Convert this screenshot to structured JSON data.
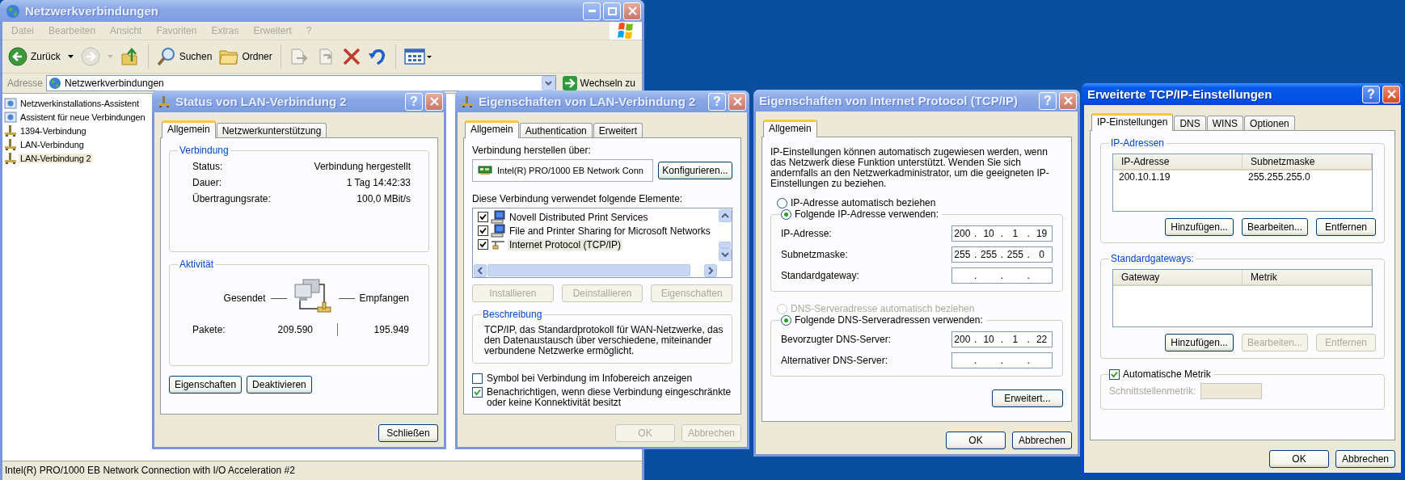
{
  "explorer": {
    "title": "Netzwerkverbindungen",
    "active": false,
    "menu": [
      "Datei",
      "Bearbeiten",
      "Ansicht",
      "Favoriten",
      "Extras",
      "Erweitert",
      "?"
    ],
    "toolbar": {
      "back": "Zurück",
      "search": "Suchen",
      "folders": "Ordner"
    },
    "address": {
      "label": "Adresse",
      "value": "Netzwerkverbindungen",
      "go": "Wechseln zu"
    },
    "items": [
      {
        "label": "Netzwerkinstallations-Assistent",
        "kind": "wizard",
        "selected": false
      },
      {
        "label": "Assistent für neue Verbindungen",
        "kind": "wizard",
        "selected": false
      },
      {
        "label": "1394-Verbindung",
        "kind": "connection",
        "selected": false
      },
      {
        "label": "LAN-Verbindung",
        "kind": "connection",
        "selected": false
      },
      {
        "label": "LAN-Verbindung 2",
        "kind": "connection",
        "selected": true
      }
    ],
    "status_bar": "Intel(R) PRO/1000 EB Network Connection with I/O Acceleration #2"
  },
  "status_dialog": {
    "title": "Status von LAN-Verbindung 2",
    "active": false,
    "help": "?",
    "tabs": [
      {
        "label": "Allgemein",
        "selected": true
      },
      {
        "label": "Netzwerkunterstützung",
        "selected": false
      }
    ],
    "connection": {
      "title": "Verbindung",
      "rows": [
        {
          "label": "Status:",
          "value": "Verbindung hergestellt"
        },
        {
          "label": "Dauer:",
          "value": "1 Tag 14:42:33"
        },
        {
          "label": "Übertragungsrate:",
          "value": "100,0 MBit/s"
        }
      ]
    },
    "activity": {
      "title": "Aktivität",
      "sent_label": "Gesendet",
      "received_label": "Empfangen",
      "packets_label": "Pakete:",
      "packets_sent": "209.590",
      "packets_received": "195.949"
    },
    "buttons": [
      "Eigenschaften",
      "Deaktivieren"
    ],
    "close": "Schließen"
  },
  "properties_dialog": {
    "title": "Eigenschaften von LAN-Verbindung 2",
    "active": false,
    "help": "?",
    "tabs": [
      {
        "label": "Allgemein",
        "selected": true
      },
      {
        "label": "Authentication",
        "selected": false
      },
      {
        "label": "Erweitert",
        "selected": false
      }
    ],
    "connect_label": "Verbindung herstellen über:",
    "adapter": "Intel(R) PRO/1000 EB Network Conn",
    "configure": "Konfigurieren...",
    "components_label": "Diese Verbindung verwendet folgende Elemente:",
    "components": [
      {
        "label": "Novell Distributed Print Services",
        "kind": "service",
        "checked": true,
        "selected": false
      },
      {
        "label": "File and Printer Sharing for Microsoft Networks",
        "kind": "service",
        "checked": true,
        "selected": false
      },
      {
        "label": "Internet Protocol (TCP/IP)",
        "kind": "protocol",
        "checked": true,
        "selected": true
      }
    ],
    "component_buttons": [
      {
        "label": "Installieren",
        "disabled": true
      },
      {
        "label": "Deinstallieren",
        "disabled": true
      },
      {
        "label": "Eigenschaften",
        "disabled": true
      }
    ],
    "description": {
      "title": "Beschreibung",
      "text": "TCP/IP, das Standardprotokoll für WAN-Netzwerke, das den Datenaustausch über verschiedene, miteinander verbundene Netzwerke ermöglicht."
    },
    "options": [
      {
        "label": "Symbol bei Verbindung im Infobereich anzeigen",
        "checked": false
      },
      {
        "label": "Benachrichtigen, wenn diese Verbindung eingeschränkte oder keine Konnektivität besitzt",
        "checked": true
      }
    ],
    "buttons": [
      {
        "label": "OK",
        "disabled": true
      },
      {
        "label": "Abbrechen",
        "disabled": true
      }
    ]
  },
  "tcpip_dialog": {
    "title": "Eigenschaften von Internet Protocol (TCP/IP)",
    "active": false,
    "help": "?",
    "tabs": [
      {
        "label": "Allgemein",
        "selected": true
      }
    ],
    "intro": "IP-Einstellungen können automatisch zugewiesen werden, wenn das Netzwerk diese Funktion unterstützt. Wenden Sie sich andernfalls an den Netzwerkadministrator, um die geeigneten IP-Einstellungen zu beziehen.",
    "separator": ".",
    "ip_options": [
      {
        "label": "IP-Adresse automatisch beziehen",
        "selected": false,
        "disabled": false
      },
      {
        "label": "Folgende IP-Adresse verwenden:",
        "selected": true,
        "disabled": false
      }
    ],
    "ip_fields": [
      {
        "label": "IP-Adresse:",
        "octets": [
          "200",
          "10",
          "1",
          "19"
        ]
      },
      {
        "label": "Subnetzmaske:",
        "octets": [
          "255",
          "255",
          "255",
          "0"
        ]
      },
      {
        "label": "Standardgateway:"
      }
    ],
    "dns_options": [
      {
        "label": "DNS-Serveradresse automatisch beziehen",
        "selected": false,
        "disabled": true
      },
      {
        "label": "Folgende DNS-Serveradressen verwenden:",
        "selected": true,
        "disabled": false
      }
    ],
    "dns_fields": [
      {
        "label": "Bevorzugter DNS-Server:",
        "octets": [
          "200",
          "10",
          "1",
          "22"
        ]
      },
      {
        "label": "Alternativer DNS-Server:"
      }
    ],
    "advanced": "Erweitert...",
    "buttons": [
      {
        "label": "OK",
        "disabled": false
      },
      {
        "label": "Abbrechen",
        "disabled": false
      }
    ]
  },
  "advanced_dialog": {
    "title": "Erweiterte TCP/IP-Einstellungen",
    "active": true,
    "help": "?",
    "tabs": [
      {
        "label": "IP-Einstellungen",
        "selected": true
      },
      {
        "label": "DNS",
        "selected": false
      },
      {
        "label": "WINS",
        "selected": false
      },
      {
        "label": "Optionen",
        "selected": false
      }
    ],
    "ip_group": {
      "title": "IP-Adressen",
      "columns": [
        "IP-Adresse",
        "Subnetzmaske"
      ],
      "rows": [
        [
          "200.10.1.19",
          "255.255.255.0"
        ]
      ],
      "buttons": [
        {
          "label": "Hinzufügen...",
          "disabled": false
        },
        {
          "label": "Bearbeiten...",
          "disabled": false
        },
        {
          "label": "Entfernen",
          "disabled": false
        }
      ]
    },
    "gateway_group": {
      "title": "Standardgateways:",
      "columns": [
        "Gateway",
        "Metrik"
      ],
      "buttons": [
        {
          "label": "Hinzufügen...",
          "disabled": false
        },
        {
          "label": "Bearbeiten...",
          "disabled": true
        },
        {
          "label": "Entfernen",
          "disabled": true
        }
      ]
    },
    "metric": {
      "label": "Automatische Metrik",
      "checked": true,
      "field_label": "Schnittstellenmetrik:",
      "field_disabled": true
    },
    "buttons": [
      {
        "label": "OK",
        "disabled": false
      },
      {
        "label": "Abbrechen",
        "disabled": false
      }
    ]
  }
}
